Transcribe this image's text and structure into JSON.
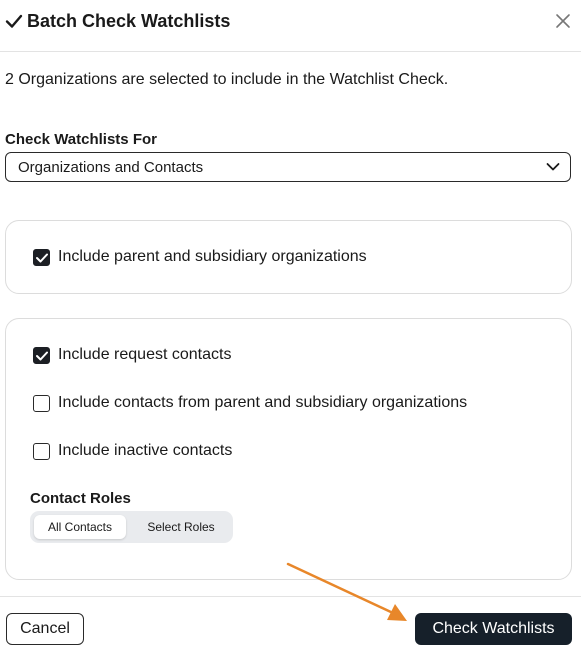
{
  "dialog": {
    "title": "Batch Check Watchlists",
    "intro": "2 Organizations are selected to include in the Watchlist Check."
  },
  "check_for": {
    "label": "Check Watchlists For",
    "selected": "Organizations and Contacts"
  },
  "options": {
    "parent_subsidiary": {
      "label": "Include parent and subsidiary organizations",
      "checked": true
    },
    "request_contacts": {
      "label": "Include request contacts",
      "checked": true
    },
    "contacts_parent_subsidiary": {
      "label": "Include contacts from parent and subsidiary organizations",
      "checked": false
    },
    "inactive_contacts": {
      "label": "Include inactive contacts",
      "checked": false
    }
  },
  "contact_roles": {
    "label": "Contact Roles",
    "options": [
      "All Contacts",
      "Select Roles"
    ],
    "selected": "All Contacts"
  },
  "footer": {
    "cancel_label": "Cancel",
    "submit_label": "Check Watchlists"
  },
  "annotation": {
    "arrow_color": "#e8872a"
  }
}
